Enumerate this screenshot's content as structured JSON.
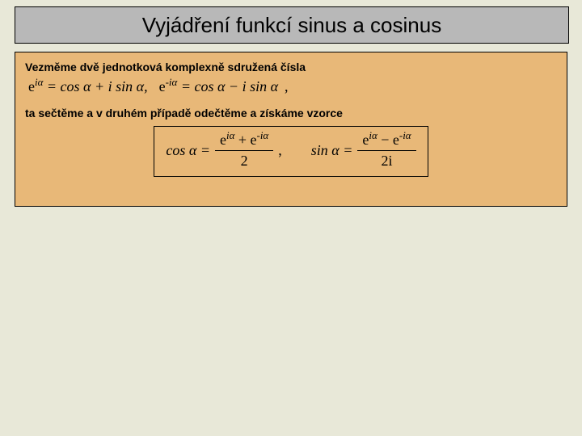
{
  "title": "Vyjádření funkcí sinus a cosinus",
  "line1": "Vezměme dvě jednotková komplexně sdružená čísla",
  "eq1": {
    "a_lhs": "e",
    "a_exp": "iα",
    "a_rhs": " = cos α + i sin α,",
    "b_lhs": "e",
    "b_exp": "-iα",
    "b_rhs": " = cos α − i sin α",
    "trailing": ","
  },
  "line2": "ta sečtěme a v druhém případě odečtěme a získáme vzorce",
  "boxed": {
    "cos_lhs": "cos α =",
    "cos_num_a": "e",
    "cos_num_a_exp": "iα",
    "cos_num_plus": " + e",
    "cos_num_b_exp": "-iα",
    "cos_den": "2",
    "sep": ",",
    "sin_lhs": "sin α =",
    "sin_num_a": "e",
    "sin_num_a_exp": "iα",
    "sin_num_minus": " − e",
    "sin_num_b_exp": "-iα",
    "sin_den": "2i"
  }
}
